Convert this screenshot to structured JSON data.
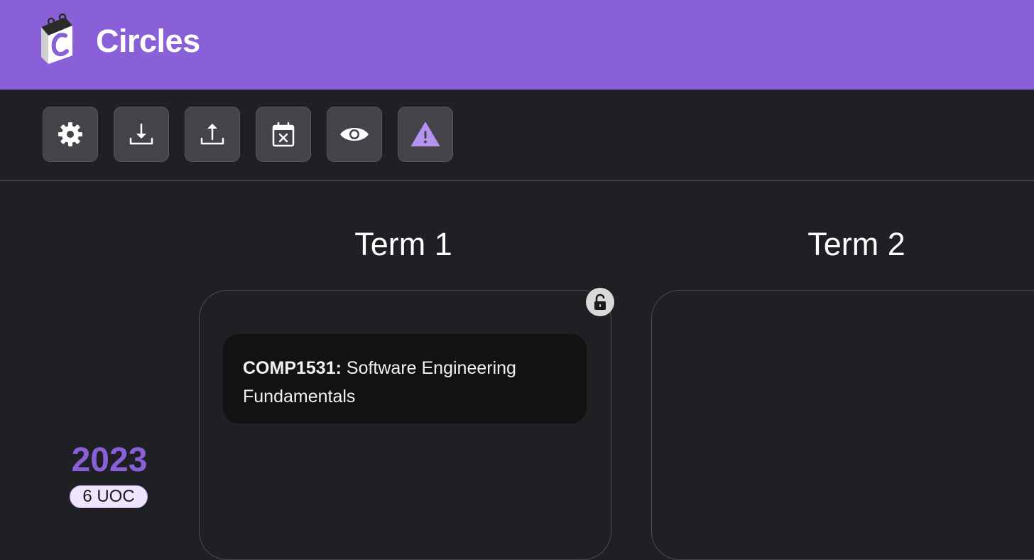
{
  "app": {
    "title": "Circles"
  },
  "toolbar": {
    "buttons": [
      {
        "icon": "gear-icon"
      },
      {
        "icon": "download-icon"
      },
      {
        "icon": "upload-icon"
      },
      {
        "icon": "calendar-x-icon"
      },
      {
        "icon": "eye-icon"
      },
      {
        "icon": "warning-icon"
      }
    ]
  },
  "terms": [
    {
      "label": "Term 1"
    },
    {
      "label": "Term 2"
    }
  ],
  "course": {
    "code": "COMP1531:",
    "name": " Software Engineering Fundamentals"
  },
  "year": {
    "label": "2023",
    "uoc": "6 UOC"
  },
  "colors": {
    "brand": "#8a60d8",
    "background": "#1e2023",
    "card": "#121212"
  }
}
